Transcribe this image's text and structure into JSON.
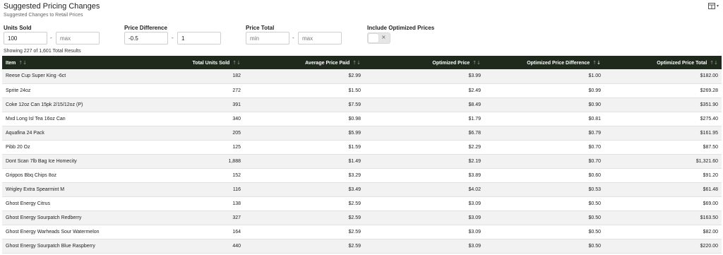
{
  "header": {
    "title": "Suggested Pricing Changes",
    "subtitle": "Suggested Changes to Retail Prices",
    "icon": "table-view-icon",
    "caret": "▾"
  },
  "filters": {
    "units_sold": {
      "label": "Units Sold",
      "min_value": "100",
      "max_value": "",
      "min_placeholder": "min",
      "max_placeholder": "max"
    },
    "price_difference": {
      "label": "Price Difference",
      "min_value": "-0.5",
      "max_value": "1",
      "min_placeholder": "min",
      "max_placeholder": "max"
    },
    "price_total": {
      "label": "Price Total",
      "min_value": "",
      "max_value": "",
      "min_placeholder": "min",
      "max_placeholder": "max"
    },
    "include_optimized": {
      "label": "Include Optimized Prices",
      "checked": false,
      "off_symbol": "×"
    },
    "separator": "-"
  },
  "results_text": "Showing 227 of 1,601 Total Results",
  "table": {
    "sort_up": "↑",
    "sort_down": "↓",
    "columns": [
      {
        "label": "Item",
        "align": "l"
      },
      {
        "label": "Total Units Sold",
        "align": "r"
      },
      {
        "label": "Average Price Paid",
        "align": "r"
      },
      {
        "label": "Optimized Price",
        "align": "r"
      },
      {
        "label": "Optimized Price Difference",
        "align": "r"
      },
      {
        "label": "Optimized Price Total",
        "align": "r"
      }
    ],
    "active_sort_column": 4,
    "rows": [
      [
        "Reese Cup Super King -6ct",
        "182",
        "$2.99",
        "$3.99",
        "$1.00",
        "$182.00"
      ],
      [
        "Sprite 24oz",
        "272",
        "$1.50",
        "$2.49",
        "$0.99",
        "$269.28"
      ],
      [
        "Coke 12oz Can 15pk 2/15/12oz (P)",
        "391",
        "$7.59",
        "$8.49",
        "$0.90",
        "$351.90"
      ],
      [
        "Mxd Long Isl Tea 16oz Can",
        "340",
        "$0.98",
        "$1.79",
        "$0.81",
        "$275.40"
      ],
      [
        "Aquafina 24 Pack",
        "205",
        "$5.99",
        "$6.78",
        "$0.79",
        "$161.95"
      ],
      [
        "Pibb 20 Oz",
        "125",
        "$1.59",
        "$2.29",
        "$0.70",
        "$87.50"
      ],
      [
        "Dont Scan 7lb Bag Ice Homecity",
        "1,888",
        "$1.49",
        "$2.19",
        "$0.70",
        "$1,321.60"
      ],
      [
        "Grippos Bbq Chips 8oz",
        "152",
        "$3.29",
        "$3.89",
        "$0.60",
        "$91.20"
      ],
      [
        "Wrigley Extra Spearmint M",
        "116",
        "$3.49",
        "$4.02",
        "$0.53",
        "$61.48"
      ],
      [
        "Ghost Energy Citrus",
        "138",
        "$2.59",
        "$3.09",
        "$0.50",
        "$69.00"
      ],
      [
        "Ghost Energy Sourpatch Redberry",
        "327",
        "$2.59",
        "$3.09",
        "$0.50",
        "$163.50"
      ],
      [
        "Ghost Energy Warheads Sour Watermelon",
        "164",
        "$2.59",
        "$3.09",
        "$0.50",
        "$82.00"
      ],
      [
        "Ghost Energy Sourpatch Blue Raspberry",
        "440",
        "$2.59",
        "$3.09",
        "$0.50",
        "$220.00"
      ]
    ]
  }
}
